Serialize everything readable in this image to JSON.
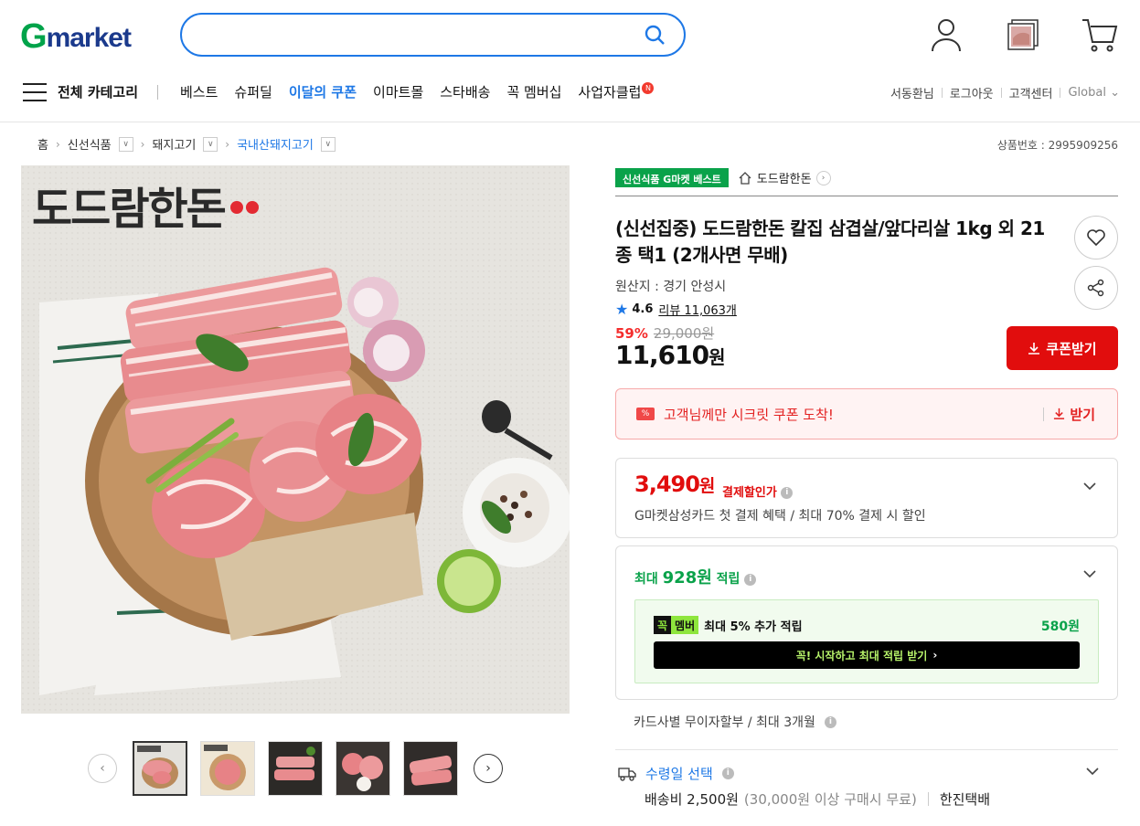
{
  "header": {
    "logo_g": "G",
    "logo_rest": "market",
    "search_placeholder": "",
    "icons": [
      "user-icon",
      "recent-view-icon",
      "cart-icon"
    ]
  },
  "nav": {
    "menu_label": "전체 카테고리",
    "items": [
      "베스트",
      "슈퍼딜",
      "이달의 쿠폰",
      "이마트몰",
      "스타배송",
      "꼭 멤버십",
      "사업자클럽"
    ],
    "new_badge": "N",
    "util": [
      "서동환님",
      "로그아웃",
      "고객센터",
      "Global"
    ],
    "global_chevron": "⌄"
  },
  "breadcrumb": {
    "items": [
      "홈",
      "신선식품",
      "돼지고기",
      "국내산돼지고기"
    ],
    "product_no": "상품번호 : 2995909256"
  },
  "image": {
    "brand_text": "도드람한돈"
  },
  "product": {
    "badge": "신선식품 G마켓 베스트",
    "shop": "도드람한돈",
    "title": "(신선집중) 도드람한돈 칼집 삼겹살/앞다리살 1kg 외 21종 택1 (2개사면 무배)",
    "origin": "원산지 : 경기 안성시",
    "rating": "4.6",
    "reviews": "리뷰 11,063개",
    "discount_pct": "59%",
    "original_price": "29,000원",
    "price": "11,610",
    "price_unit": "원",
    "coupon_button": "쿠폰받기"
  },
  "secret_coupon": {
    "text": "고객님께만 시크릿 쿠폰 도착!",
    "get": "받기"
  },
  "card_discount": {
    "amount": "3,490",
    "unit": "원",
    "label": "결제할인가",
    "desc": "G마켓삼성카드 첫 결제 혜택 / 최대 70% 결제 시 할인"
  },
  "points": {
    "prefix": "최대 ",
    "amount": "928원",
    "suffix": " 적립",
    "member_logo_a": "꼭",
    "member_logo_b": "멤버",
    "member_text": "최대 5% 추가 적립",
    "member_amount": "580원",
    "member_button": "꼭! 시작하고 최대 적립 받기"
  },
  "installment": "카드사별 무이자할부 / 최대 3개월",
  "shipping": {
    "select": "수령일 선택",
    "fee": "배송비 2,500원",
    "note": "(30,000원 이상 구매시 무료)",
    "carrier": "한진택배"
  },
  "colors": {
    "accent_blue": "#1e78e6",
    "price_red": "#e10d0d",
    "green": "#0aa24a"
  }
}
